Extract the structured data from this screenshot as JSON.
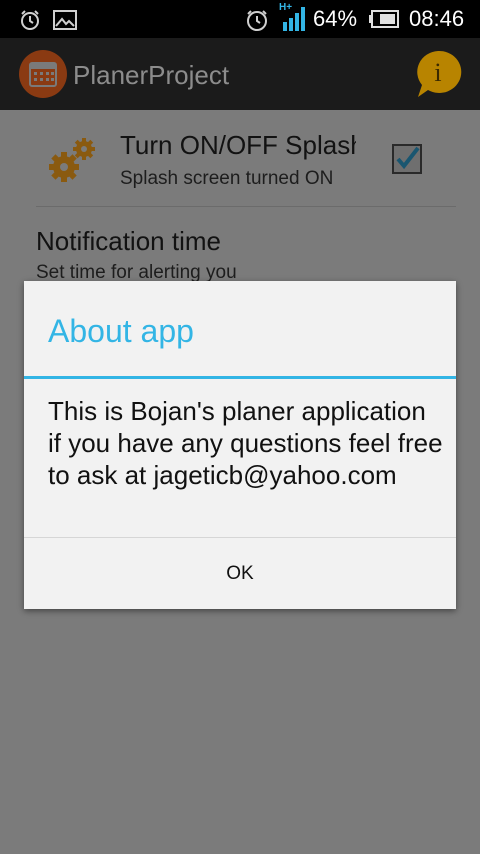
{
  "status_bar": {
    "left_icons": [
      "alarm-icon",
      "image-notification-icon"
    ],
    "right_icons": [
      "alarm-clock-icon",
      "hspa-signal-icon",
      "battery-icon"
    ],
    "network_badge": "H+",
    "battery": "64%",
    "time": "08:46"
  },
  "action_bar": {
    "title": "PlanerProject",
    "logo_icon": "calendar-icon",
    "action_icon": "info-icon",
    "info_glyph": "i",
    "colors": {
      "logo": "#8a3a12",
      "info": "#b88400"
    }
  },
  "preferences": [
    {
      "icon": "gears-icon",
      "title": "Turn ON/OFF Splash screen",
      "summary": "Splash screen turned ON",
      "checked": true
    },
    {
      "title": "Notification time",
      "summary": "Set time for alerting you"
    }
  ],
  "dialog": {
    "title": "About app",
    "message": "This is Bojan's planer application if you have any questions feel free to ask at jageticb@yahoo.com",
    "ok_label": "OK",
    "accent_color": "#33b5e5"
  }
}
